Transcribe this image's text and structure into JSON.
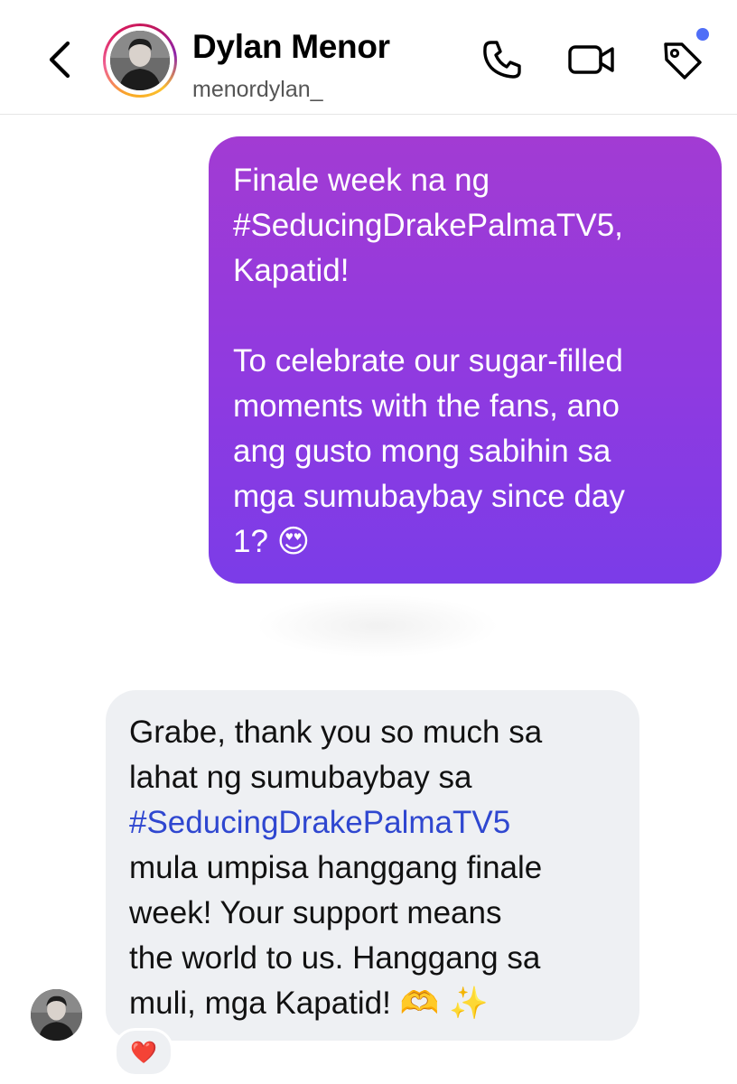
{
  "header": {
    "name": "Dylan Menor",
    "username": "menordylan_",
    "icons": {
      "back": "chevron-left-icon",
      "call": "phone-icon",
      "video": "video-camera-icon",
      "tag": "tag-icon"
    },
    "notification_dot_color": "#4f6ef7",
    "story_ring_colors": [
      "#f9a825",
      "#d81b60",
      "#8e24aa"
    ]
  },
  "messages": {
    "sent": {
      "paragraph1_line1": "Finale week na ng",
      "paragraph1_line2": "#SeducingDrakePalmaTV5,",
      "paragraph1_line3": "Kapatid!",
      "paragraph2_line1": "To celebrate our sugar-filled",
      "paragraph2_line2": "moments with the fans, ano",
      "paragraph2_line3": "ang gusto mong sabihin sa",
      "paragraph2_line4": "mga sumubaybay since day",
      "paragraph2_line5": "1?",
      "emoji": "😍",
      "gradient_colors": [
        "#a23bd3",
        "#7b3ce8"
      ]
    },
    "received": {
      "line1": "Grabe, thank you so much sa",
      "line2": "lahat ng sumubaybay sa",
      "hashtag": "#SeducingDrakePalmaTV5",
      "line4": "mula umpisa hanggang finale",
      "line5": "week! Your support means",
      "line6": "the world to us. Hanggang sa",
      "line7": "muli, mga Kapatid!",
      "emojis": "🫶 ✨",
      "reaction": "❤️",
      "hashtag_color": "#2f47d0"
    }
  }
}
